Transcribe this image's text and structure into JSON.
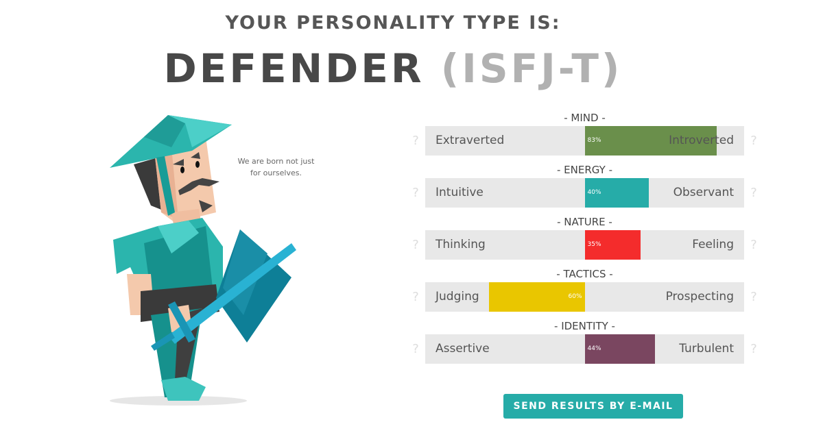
{
  "header": {
    "subtitle": "YOUR PERSONALITY TYPE IS:",
    "type_name": "DEFENDER",
    "type_code": "(ISFJ-T)"
  },
  "figure": {
    "character": "defender-knight-illustration",
    "quote": "We are born not just for ourselves."
  },
  "scales": [
    {
      "heading": "- MIND -",
      "left_trait": "Extraverted",
      "right_trait": "Introverted",
      "percent": 83,
      "percent_label": "83%",
      "direction": "right",
      "color": "#6a8f4b"
    },
    {
      "heading": "- ENERGY -",
      "left_trait": "Intuitive",
      "right_trait": "Observant",
      "percent": 40,
      "percent_label": "40%",
      "direction": "right",
      "color": "#26aca8"
    },
    {
      "heading": "- NATURE -",
      "left_trait": "Thinking",
      "right_trait": "Feeling",
      "percent": 35,
      "percent_label": "35%",
      "direction": "right",
      "color": "#f42c2c"
    },
    {
      "heading": "- TACTICS -",
      "left_trait": "Judging",
      "right_trait": "Prospecting",
      "percent": 60,
      "percent_label": "60%",
      "direction": "left",
      "color": "#e9c600"
    },
    {
      "heading": "- IDENTITY -",
      "left_trait": "Assertive",
      "right_trait": "Turbulent",
      "percent": 44,
      "percent_label": "44%",
      "direction": "right",
      "color": "#7a4660"
    }
  ],
  "help_glyph": "?",
  "actions": {
    "email_button": "SEND RESULTS BY E-MAIL"
  },
  "colors": {
    "accent": "#26aca8",
    "title": "#484848",
    "code": "#b1b1b1",
    "track": "#e8e8e8"
  }
}
